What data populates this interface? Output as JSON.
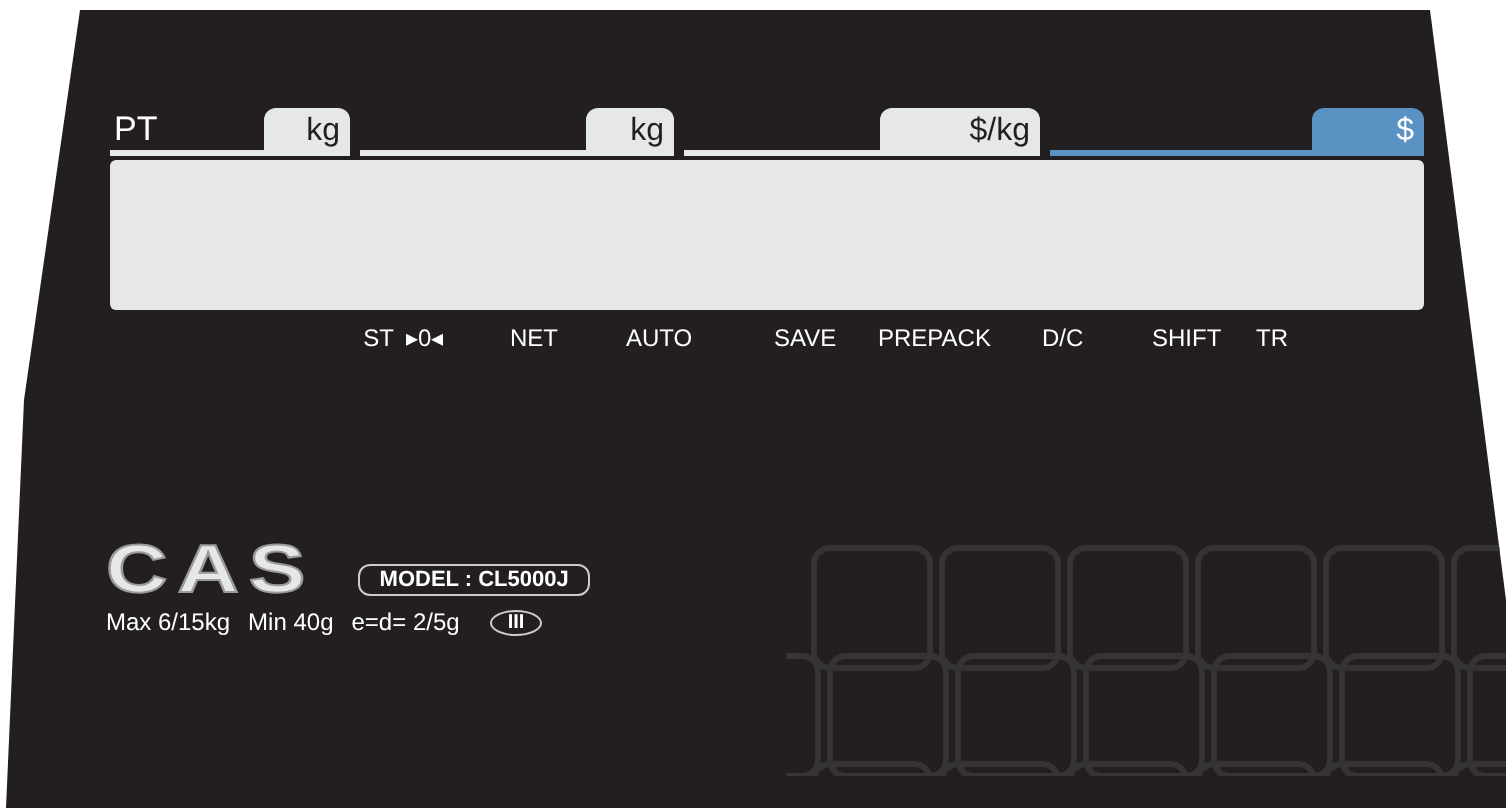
{
  "display": {
    "sections": [
      {
        "label": "PT",
        "unit": "kg",
        "selected": false
      },
      {
        "unit": "kg",
        "selected": false
      },
      {
        "unit": "$/kg",
        "selected": false
      },
      {
        "unit": "$",
        "selected": true
      }
    ]
  },
  "indicators": [
    "ST",
    "▸0◂",
    "NET",
    "AUTO",
    "SAVE",
    "PREPACK",
    "D/C",
    "SHIFT",
    "TR"
  ],
  "brand": {
    "logo": "CAS",
    "model": "MODEL : CL5000J",
    "specs": [
      "Max 6/15kg",
      "Min 40g",
      "e=d= 2/5g"
    ],
    "accuracy_class": "III"
  }
}
